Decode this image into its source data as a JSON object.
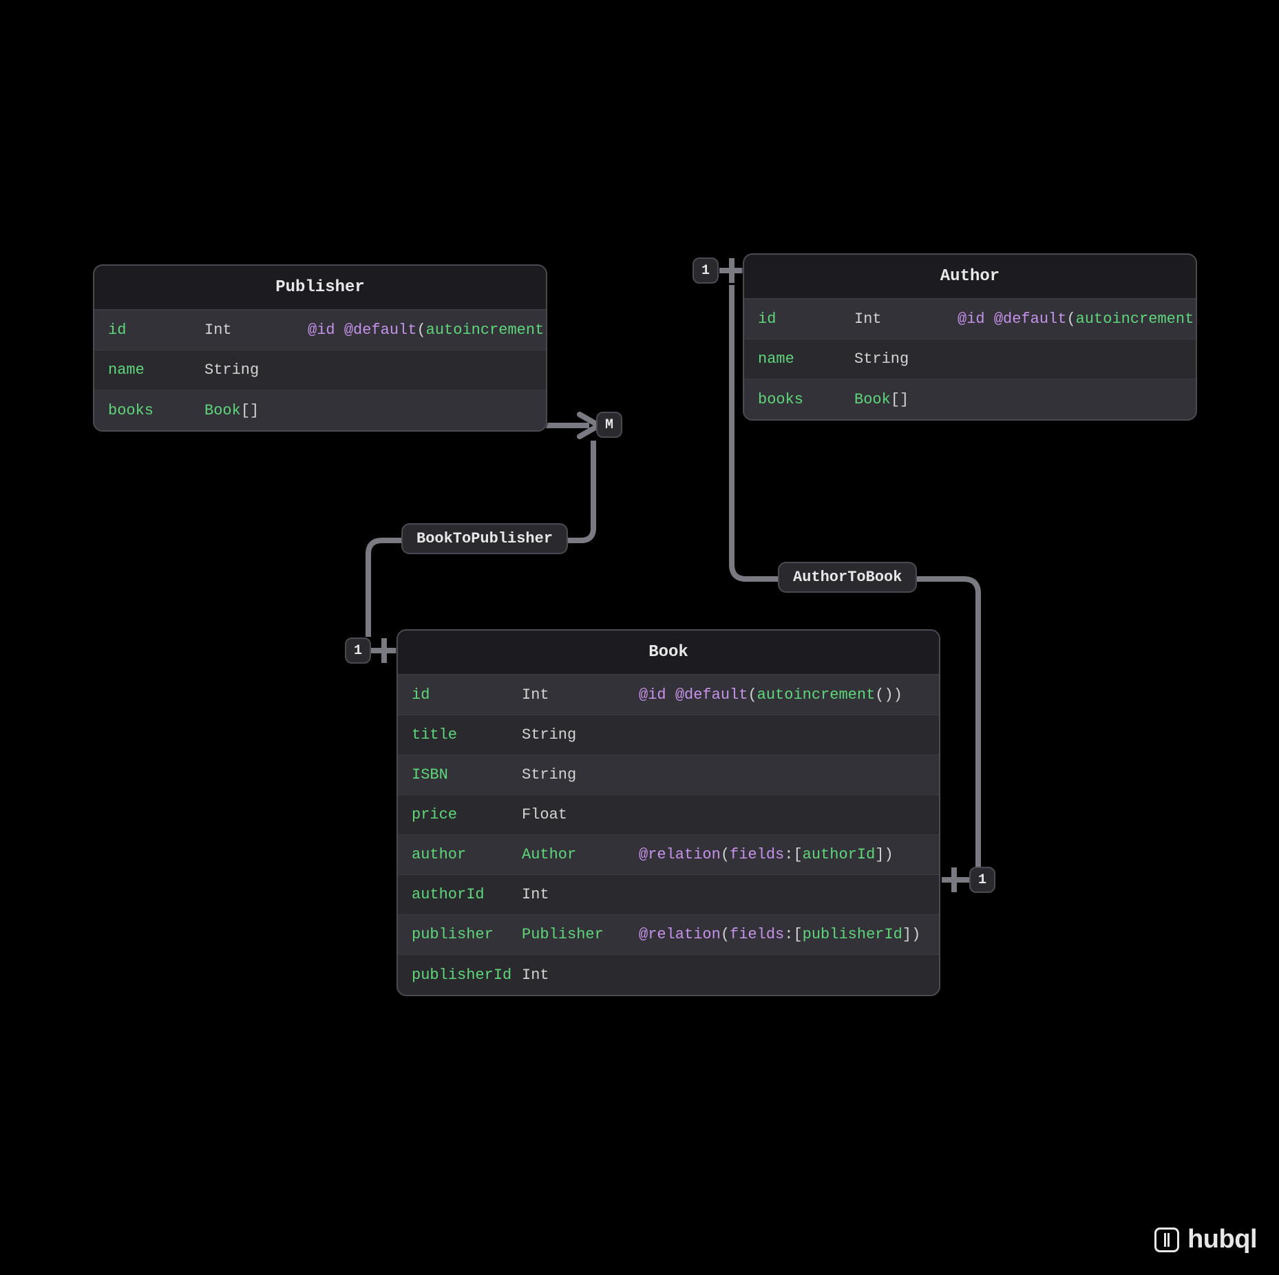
{
  "brand": "hubql",
  "entities": {
    "publisher": {
      "title": "Publisher",
      "rows": [
        {
          "name": "id",
          "type": "Int",
          "attrs": {
            "kind": "id_default",
            "fn": "autoincrement"
          }
        },
        {
          "name": "name",
          "type": "String"
        },
        {
          "name": "books",
          "type": "Book",
          "isArray": true
        }
      ]
    },
    "author": {
      "title": "Author",
      "rows": [
        {
          "name": "id",
          "type": "Int",
          "attrs": {
            "kind": "id_default",
            "fn": "autoincrement"
          }
        },
        {
          "name": "name",
          "type": "String"
        },
        {
          "name": "books",
          "type": "Book",
          "isArray": true
        }
      ]
    },
    "book": {
      "title": "Book",
      "rows": [
        {
          "name": "id",
          "type": "Int",
          "attrs": {
            "kind": "id_default",
            "fn": "autoincrement"
          }
        },
        {
          "name": "title",
          "type": "String"
        },
        {
          "name": "ISBN",
          "type": "String"
        },
        {
          "name": "price",
          "type": "Float"
        },
        {
          "name": "author",
          "type": "Author",
          "isModel": true,
          "attrs": {
            "kind": "relation",
            "field": "authorId"
          }
        },
        {
          "name": "authorId",
          "type": "Int"
        },
        {
          "name": "publisher",
          "type": "Publisher",
          "isModel": true,
          "attrs": {
            "kind": "relation",
            "field": "publisherId"
          }
        },
        {
          "name": "publisherId",
          "type": "Int"
        }
      ]
    }
  },
  "relations": {
    "bookToPublisher": {
      "label": "BookToPublisher",
      "from_card": "1",
      "to_card": "M"
    },
    "authorToBook": {
      "label": "AuthorToBook",
      "from_card": "1",
      "to_card": "1"
    }
  },
  "tokens": {
    "at_id": "@id",
    "at_default": "@default",
    "at_relation": "@relation",
    "fields_key": "fields",
    "lparen": "(",
    "rparen": ")",
    "lbr": "[",
    "rbr": "]",
    "colon": ":",
    "array_sfx": "[]"
  }
}
